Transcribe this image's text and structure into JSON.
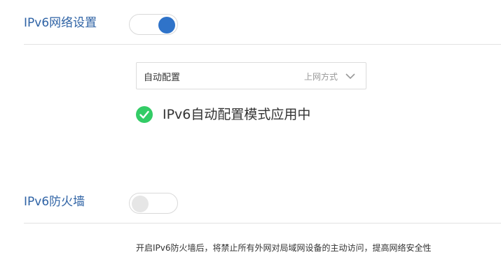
{
  "ipv6_network": {
    "title": "IPv6网络设置",
    "toggle_on": true,
    "mode_select": {
      "value": "自动配置",
      "hint": "上网方式"
    },
    "status_text": "IPv6自动配置模式应用中",
    "status_color": "#33cc66",
    "accent_color": "#2f73c9"
  },
  "ipv6_firewall": {
    "title": "IPv6防火墙",
    "toggle_on": false,
    "note": "开启IPv6防火墙后，将禁止所有外网对局域网设备的主动访问，提高网络安全性"
  },
  "icons": {
    "chevron": "chevron-down-icon",
    "status": "check-circle-icon"
  }
}
